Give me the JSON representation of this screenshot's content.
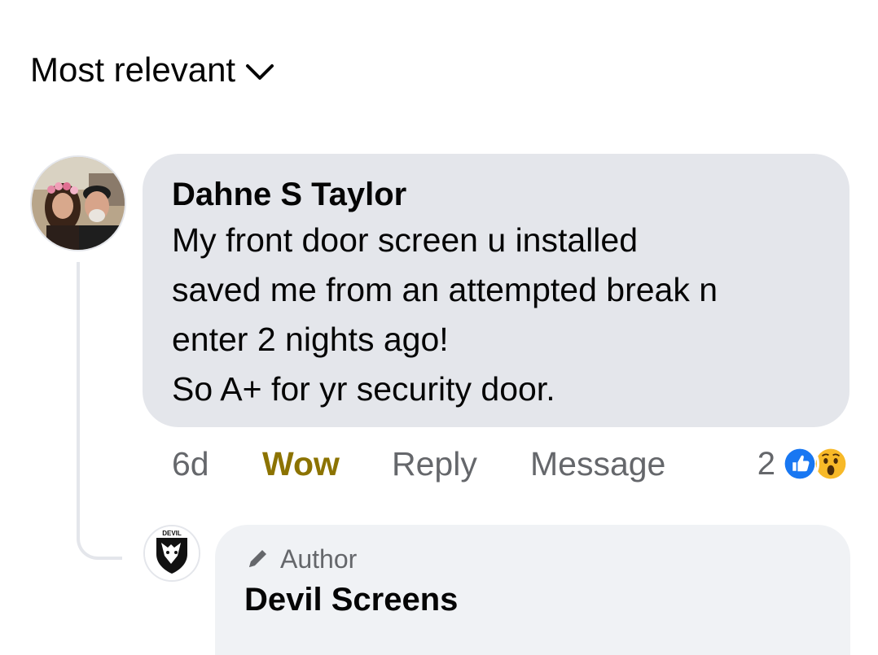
{
  "sort": {
    "label": "Most relevant",
    "icon": "chevron-down-icon"
  },
  "comment": {
    "author": "Dahne S Taylor",
    "lines": [
      "My front door screen u installed",
      "saved me from an attempted break n",
      "enter 2 nights ago!",
      "So A+ for yr security door."
    ],
    "time": "6d",
    "reaction_label": "Wow",
    "reply_label": "Reply",
    "message_label": "Message",
    "reaction_count": "2",
    "reaction_icons": [
      "like-icon",
      "wow-icon"
    ],
    "colors": {
      "bubble": "#e4e6eb",
      "wow": "#8c7300",
      "like": "#1877f2",
      "wow_face": "#f7b928"
    }
  },
  "reply": {
    "badge": "Author",
    "badge_icon": "pencil-icon",
    "author": "Devil Screens",
    "avatar_text": "DEVIL"
  }
}
